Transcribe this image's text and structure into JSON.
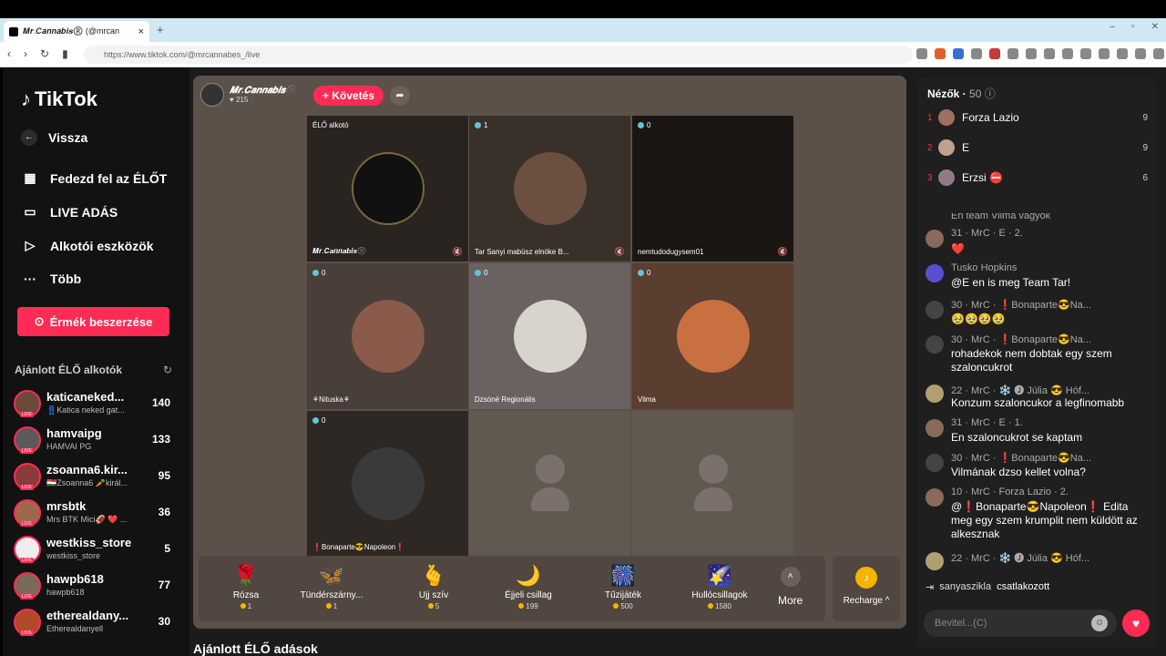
{
  "browser": {
    "tab_title": "𝑴𝒓.𝑪𝒂𝒏𝒏𝒂𝒃𝒊𝒔®️ (@mrcan",
    "url": "https://www.tiktok.com/@mrcannabes_/live"
  },
  "sidebar": {
    "logo": "TikTok",
    "back": "Vissza",
    "nav": [
      "Fedezd fel az ÉLŐT",
      "LIVE ADÁS",
      "Alkotói eszközök",
      "Több"
    ],
    "coin_button": "Érmék beszerzése",
    "recommended_title": "Ajánlott ÉLŐ alkotók",
    "creators": [
      {
        "name": "katicaneked...",
        "sub": "👖Katica neked gat...",
        "count": "140"
      },
      {
        "name": "hamvaipg",
        "sub": "HAMVAI PG",
        "count": "133"
      },
      {
        "name": "zsoanna6.kir...",
        "sub": "🇭🇺Zsoanna6 🥕királ...",
        "count": "95"
      },
      {
        "name": "mrsbtk",
        "sub": "Mrs BTK Mici🏈 ❤️ ...",
        "count": "36"
      },
      {
        "name": "westkiss_store",
        "sub": "westkiss_store",
        "count": "5"
      },
      {
        "name": "hawpb618",
        "sub": "hawpb618",
        "count": "77"
      },
      {
        "name": "etherealdany...",
        "sub": "Etherealdanyell",
        "count": "30"
      }
    ]
  },
  "stage": {
    "host_name": "𝑴𝒓.𝑪𝒂𝒏𝒏𝒂𝒃𝒊𝒔®️",
    "host_likes": "215",
    "follow": "+ Követés",
    "cells": [
      {
        "badge": "ÉLŐ alkotó",
        "name": "𝑴𝒓.𝑪𝒂𝒏𝒏𝒂𝒃𝒊𝒔®️"
      },
      {
        "badge": "1",
        "name": "Tar Sanyi mabüsz elnöke B..."
      },
      {
        "badge": "0",
        "name": "nemtudodugysem01"
      },
      {
        "badge": "0",
        "name": "⚘Nituska⚘"
      },
      {
        "badge": "0",
        "name": "Dzsóné Regionális"
      },
      {
        "badge": "0",
        "name": "Vilma"
      },
      {
        "badge": "0",
        "name": "❗Bonaparte😎Napoleon❗"
      }
    ],
    "gifts": [
      {
        "name": "Rózsa",
        "price": "1",
        "icon": "🌹"
      },
      {
        "name": "Tündérszárny...",
        "price": "1",
        "icon": "🦋"
      },
      {
        "name": "Ujj szív",
        "price": "5",
        "icon": "🫰"
      },
      {
        "name": "Éjjeli csillag",
        "price": "199",
        "icon": "🌙"
      },
      {
        "name": "Tűzijáték",
        "price": "500",
        "icon": "🎆"
      },
      {
        "name": "Hullócsillagok",
        "price": "1580",
        "icon": "🌠"
      }
    ],
    "more": "More",
    "recharge": "Recharge ^"
  },
  "recommended_live": "Ajánlott ÉLŐ adások",
  "chat": {
    "viewers_label": "Nézők",
    "viewers_count": "50",
    "viewers": [
      {
        "rank": "1",
        "name": "Forza Lazio",
        "score": "9"
      },
      {
        "rank": "2",
        "name": "E",
        "score": "9"
      },
      {
        "rank": "3",
        "name": "Erzsi ⛔",
        "score": "6"
      }
    ],
    "messages": [
      {
        "head": "",
        "text": "En team Vilma vagyok"
      },
      {
        "head": "31 · MrC · E · 2.",
        "text": "❤️"
      },
      {
        "head": "Tusko Hopkins",
        "text": "@E en is meg Team Tar!"
      },
      {
        "head": "30 · MrC · ❗Bonaparte😎Na...",
        "text": "🥹🥹🥹🥹"
      },
      {
        "head": "30 · MrC · ❗Bonaparte😎Na...",
        "text": "rohadekok nem dobtak egy szem szaloncukrot"
      },
      {
        "head": "22 · MrC · ❄️ 🅙 Júlia 😎 Hóf...",
        "text": "Konzum szaloncukor a legfinomabb"
      },
      {
        "head": "31 · MrC · E · 1.",
        "text": "En szaloncukrot se kaptam"
      },
      {
        "head": "30 · MrC · ❗Bonaparte😎Na...",
        "text": "Vilmának dzso kellet volna?"
      },
      {
        "head": "10 · MrC · Forza Lazio · 2.",
        "text": "@❗Bonaparte😎Napoleon❗ Edita meg egy szem krumplit nem küldött az alkesznak"
      },
      {
        "head": "22 · MrC · ❄️ 🅙 Júlia 😎 Hóf...",
        "text": ""
      }
    ],
    "joined_user": "sanyaszikla",
    "joined_text": "csatlakozott",
    "input_placeholder": "Bevitel...(C)"
  }
}
